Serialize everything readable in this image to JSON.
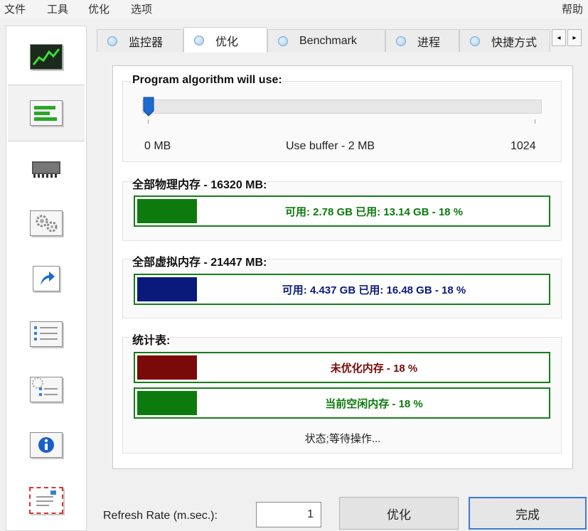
{
  "menu": {
    "items": [
      "文件",
      "工具",
      "优化",
      "选项"
    ],
    "help": "帮助"
  },
  "sidebar": {
    "items": [
      {
        "name": "monitor",
        "icon": "chart-monitor-icon"
      },
      {
        "name": "optimize",
        "icon": "memory-bars-icon",
        "active": true
      },
      {
        "name": "benchmark",
        "icon": "chip-icon"
      },
      {
        "name": "processes",
        "icon": "gears-icon"
      },
      {
        "name": "shortcuts",
        "icon": "shortcut-arrow-icon"
      },
      {
        "name": "list",
        "icon": "checklist-icon"
      },
      {
        "name": "settings",
        "icon": "gear-checklist-icon"
      },
      {
        "name": "info",
        "icon": "info-icon"
      },
      {
        "name": "mail",
        "icon": "envelope-icon"
      }
    ]
  },
  "tabs": [
    {
      "label": "监控器"
    },
    {
      "label": "优化",
      "active": true
    },
    {
      "label": "Benchmark"
    },
    {
      "label": "进程"
    },
    {
      "label": "快捷方式"
    }
  ],
  "tab_scroll": {
    "left": "◂",
    "right": "▸"
  },
  "algorithm": {
    "title": "Program algorithm will use:",
    "min_label": "0 MB",
    "mid_label": "Use buffer - 2 MB",
    "max_label": "1024",
    "slider_value_mb": 2,
    "slider_max_mb": 1024
  },
  "physical": {
    "title": "全部物理内存 - 16320 MB:",
    "bar_text": "可用: 2.78 GB  已用: 13.14 GB - 18 %",
    "percent": 18,
    "color": "#0c7a0c"
  },
  "virtual": {
    "title": "全部虚拟内存 - 21447 MB:",
    "bar_text": "可用: 4.437 GB  已用: 16.48 GB - 18 %",
    "percent": 18,
    "color": "#0a1a7a"
  },
  "stats": {
    "title": "统计表:",
    "unoptimized": {
      "text": "未优化内存 - 18 %",
      "percent": 18,
      "color": "#7a0a0a"
    },
    "free": {
      "text": "当前空闲内存 - 18 %",
      "percent": 18,
      "color": "#0c7a0c"
    },
    "status": "状态;等待操作..."
  },
  "bottom": {
    "refresh_label": "Refresh Rate (m.sec.):",
    "refresh_value": "1",
    "optimize_label": "优化",
    "done_label": "完成"
  }
}
